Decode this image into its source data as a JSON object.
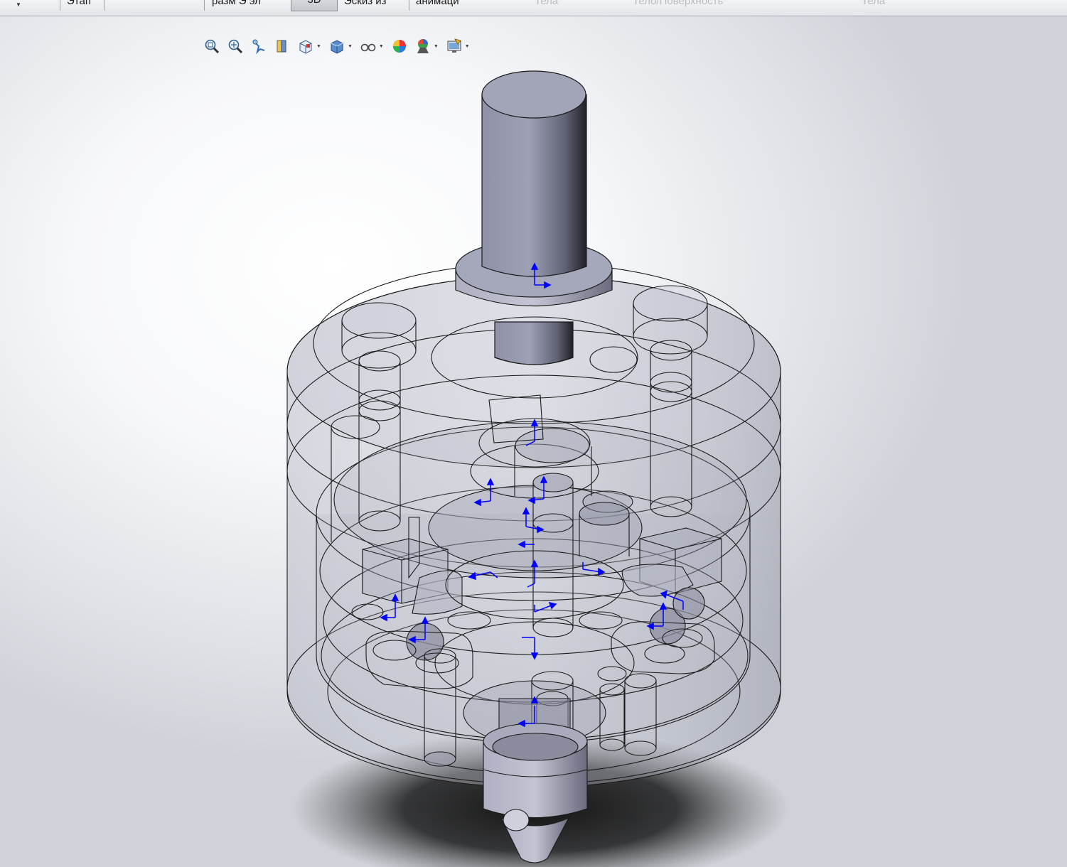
{
  "ribbon": {
    "tabs": [
      {
        "label": "Этап",
        "faded": false
      },
      {
        "label": "разм  Э эл",
        "faded": false
      },
      {
        "label": "3D",
        "faded": false,
        "active": true
      },
      {
        "label": "Эскиз из",
        "faded": false
      },
      {
        "label": "анимаци",
        "faded": false
      },
      {
        "label": "Тела",
        "faded": true
      },
      {
        "label": "Тело/Поверхность",
        "faded": true
      },
      {
        "label": "Тела",
        "faded": true
      }
    ]
  },
  "heads_up_toolbar": {
    "items": [
      {
        "icon": "zoom-to-fit-icon"
      },
      {
        "icon": "zoom-to-area-icon"
      },
      {
        "icon": "previous-view-icon"
      },
      {
        "icon": "section-view-icon"
      },
      {
        "icon": "view-orientation-icon",
        "has_dropdown": true
      },
      {
        "icon": "display-style-icon",
        "has_dropdown": true
      },
      {
        "icon": "hide-show-items-icon",
        "has_dropdown": true
      },
      {
        "icon": "edit-appearance-icon"
      },
      {
        "icon": "apply-scene-icon",
        "has_dropdown": true
      },
      {
        "icon": "view-settings-icon",
        "has_dropdown": true
      }
    ]
  },
  "model": {
    "display_mode": "transparent shaded with edges",
    "body_color": "#9a9db0",
    "edge_color": "#1b1b1b",
    "triad_color": "#0000ff"
  }
}
